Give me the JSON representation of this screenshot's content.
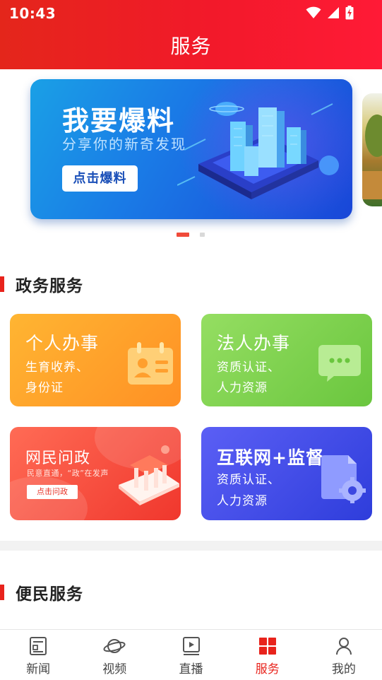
{
  "status_bar": {
    "time": "10:43"
  },
  "header": {
    "title": "服务"
  },
  "banner": {
    "title": "我要爆料",
    "subtitle": "分享你的新奇发现",
    "button_label": "点击爆料",
    "pager": {
      "active_index": 0,
      "count": 2
    }
  },
  "gov_section": {
    "title": "政务服务",
    "cards": [
      {
        "title": "个人办事",
        "desc_line1": "生育收养、",
        "desc_line2": "身份证",
        "icon": "id-card-icon",
        "color": "#ffa02a"
      },
      {
        "title": "法人办事",
        "desc_line1": "资质认证、",
        "desc_line2": "人力资源",
        "icon": "chat-bubble-icon",
        "color": "#82d350"
      },
      {
        "title": "网民问政",
        "desc": "民意直通，“政”在发声",
        "button_label": "点击问政",
        "icon": "government-building-icon",
        "color": "#f5483a"
      },
      {
        "title": "互联网+监督",
        "desc_line1": "资质认证、",
        "desc_line2": "人力资源",
        "icon": "document-gear-icon",
        "color": "#4250ea"
      }
    ]
  },
  "people_section": {
    "title": "便民服务"
  },
  "bottom_nav": {
    "items": [
      {
        "label": "新闻",
        "icon": "news-icon",
        "active": false
      },
      {
        "label": "视频",
        "icon": "planet-icon",
        "active": false
      },
      {
        "label": "直播",
        "icon": "live-play-icon",
        "active": false
      },
      {
        "label": "服务",
        "icon": "grid-icon",
        "active": true
      },
      {
        "label": "我的",
        "icon": "user-icon",
        "active": false
      }
    ]
  },
  "colors": {
    "brand_red": "#e8231c",
    "inactive_text": "#444444"
  }
}
